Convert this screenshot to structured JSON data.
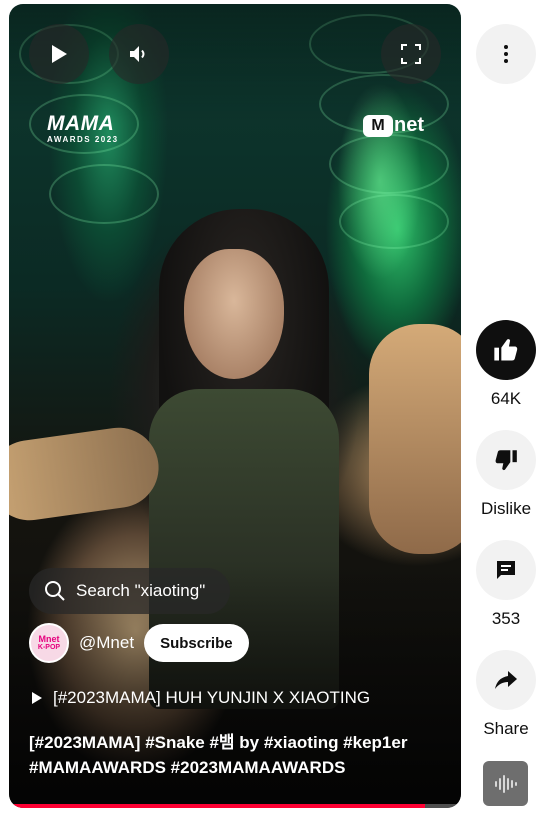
{
  "player": {
    "controls": {
      "play_icon": "play-icon",
      "volume_icon": "volume-icon",
      "fullscreen_icon": "fullscreen-icon"
    },
    "overlay_logos": {
      "left_logo": "MAMA",
      "left_logo_sub": "AWARDS 2023",
      "right_logo_mark": "M",
      "right_logo_text": "net"
    },
    "search_pill": {
      "icon": "search-icon",
      "text": "Search \"xiaoting\""
    },
    "channel": {
      "avatar_line1": "Mnet",
      "avatar_line2": "K-POP",
      "handle": "@Mnet",
      "subscribe_label": "Subscribe"
    },
    "related_video": {
      "icon": "play-triangle-icon",
      "title": "[#2023MAMA] HUH YUNJIN X XIAOTING"
    },
    "caption_line1": "[#2023MAMA] #Snake #뱀 by #xiaoting #kep1er",
    "caption_line2": "#MAMAAWARDS #2023MAMAAWARDS",
    "progress_fraction": 0.92,
    "progress_color": "#ff0033"
  },
  "actions": {
    "more_icon": "more-vertical-icon",
    "like": {
      "icon": "thumbs-up-icon",
      "count": "64K"
    },
    "dislike": {
      "icon": "thumbs-down-icon",
      "label": "Dislike"
    },
    "comments": {
      "icon": "comment-icon",
      "count": "353"
    },
    "share": {
      "icon": "share-icon",
      "label": "Share"
    },
    "sound": {
      "icon": "sound-waveform-icon"
    }
  },
  "colors": {
    "like_button_bg": "#0f0f0f",
    "rail_button_bg": "#f2f2f2",
    "text_primary": "#0f0f0f"
  }
}
